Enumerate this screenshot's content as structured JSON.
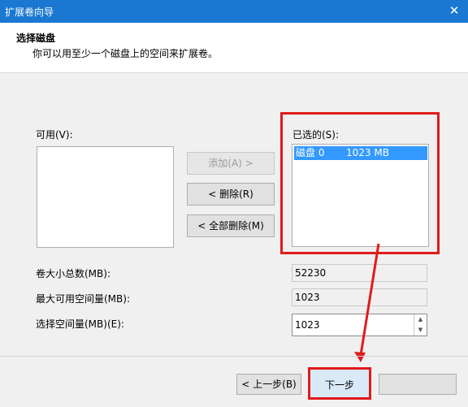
{
  "window": {
    "title": "扩展卷向导",
    "close_glyph": "✕"
  },
  "header": {
    "title": "选择磁盘",
    "subtitle": "你可以用至少一个磁盘上的空间来扩展卷。"
  },
  "available": {
    "label": "可用(V):"
  },
  "selected": {
    "label": "已选的(S):",
    "items": [
      {
        "disk": "磁盘 0",
        "size": "1023 MB"
      }
    ]
  },
  "buttons": {
    "add": "添加(A) >",
    "remove": "< 删除(R)",
    "remove_all": "< 全部删除(M)",
    "back": "< 上一步(B)",
    "next": "下一步"
  },
  "fields": {
    "total_label": "卷大小总数(MB):",
    "total_value": "52230",
    "max_label": "最大可用空间量(MB):",
    "max_value": "1023",
    "select_label": "选择空间量(MB)(E):",
    "select_value": "1023"
  },
  "accent": {
    "title_bar": "#1a77d2",
    "selection": "#3399ff",
    "annotation_red": "#e01b1b"
  }
}
